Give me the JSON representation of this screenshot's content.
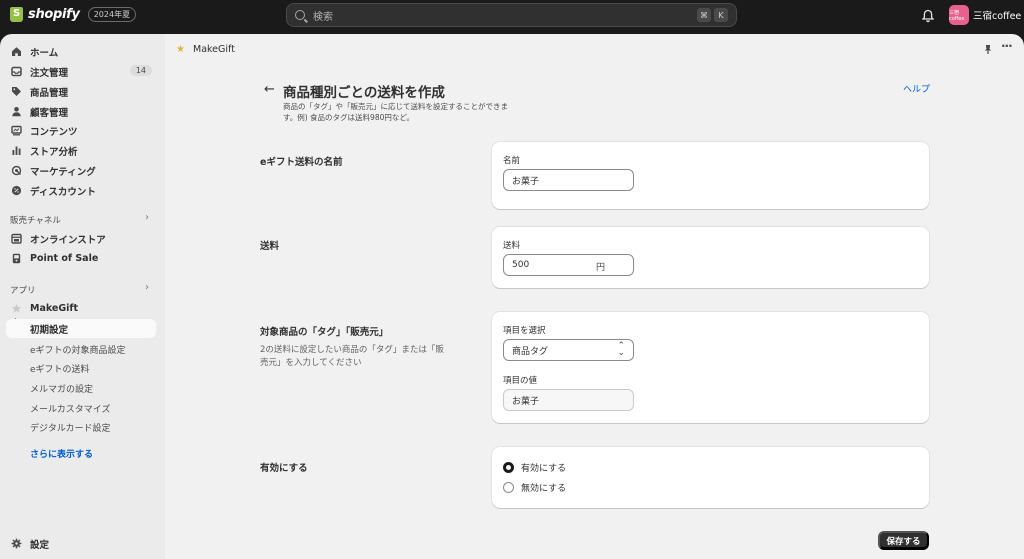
{
  "topbar": {
    "brand": "shopify",
    "edition": "2024年夏",
    "search_placeholder": "検索",
    "shortcut_keys": [
      "⌘",
      "K"
    ],
    "store_name": "三宿coffee",
    "store_avatar_text": "三宿coffee"
  },
  "sidebar": {
    "main_items": [
      {
        "label": "ホーム",
        "icon": "home-icon"
      },
      {
        "label": "注文管理",
        "icon": "inbox-icon",
        "badge": "14"
      },
      {
        "label": "商品管理",
        "icon": "tag-icon"
      },
      {
        "label": "顧客管理",
        "icon": "person-icon"
      },
      {
        "label": "コンテンツ",
        "icon": "content-icon"
      },
      {
        "label": "ストア分析",
        "icon": "chart-icon"
      },
      {
        "label": "マーケティング",
        "icon": "target-icon"
      },
      {
        "label": "ディスカウント",
        "icon": "discount-icon"
      }
    ],
    "sales_channels_title": "販売チャネル",
    "sales_channels": [
      {
        "label": "オンラインストア",
        "icon": "store-icon"
      },
      {
        "label": "Point of Sale",
        "icon": "pos-icon"
      }
    ],
    "apps_title": "アプリ",
    "app_name": "MakeGift",
    "app_active_item": "初期設定",
    "app_sub_items": [
      "eギフトの対象商品設定",
      "eギフトの送料",
      "メルマガの設定",
      "メールカスタマイズ",
      "デジタルカード設定"
    ],
    "show_more": "さらに表示する",
    "settings": "設定"
  },
  "main": {
    "app_name": "MakeGift",
    "page_title": "商品種別ごとの送料を作成",
    "page_subtitle_line1": "商品の「タグ」や「販売元」に応じて送料を設定することができま",
    "page_subtitle_line2": "す。例) 食品のタグは送料980円など。",
    "help": "ヘルプ",
    "sections": {
      "name": {
        "label": "eギフト送料の名前",
        "field_label": "名前",
        "value": "お菓子"
      },
      "shipping": {
        "label": "送料",
        "field_label": "送料",
        "value": "500",
        "suffix": "円"
      },
      "target": {
        "label": "対象商品の「タグ」「販売元」",
        "desc_line1": "2の送料に設定したい商品の「タグ」または「販",
        "desc_line2": "売元」を入力してください",
        "select_label": "項目を選択",
        "select_value": "商品タグ",
        "value_label": "項目の値",
        "value": "お菓子"
      },
      "enabled": {
        "label": "有効にする",
        "options": [
          "有効にする",
          "無効にする"
        ],
        "selected": "有効にする"
      }
    },
    "save": "保存する"
  },
  "colors": {
    "topbar_bg": "#1a1a1a",
    "sidebar_bg": "#ebebeb",
    "main_bg": "#f1f1f1",
    "link": "#005bd3",
    "save_bg": "#303030",
    "avatar_bg": "#e8608f"
  }
}
